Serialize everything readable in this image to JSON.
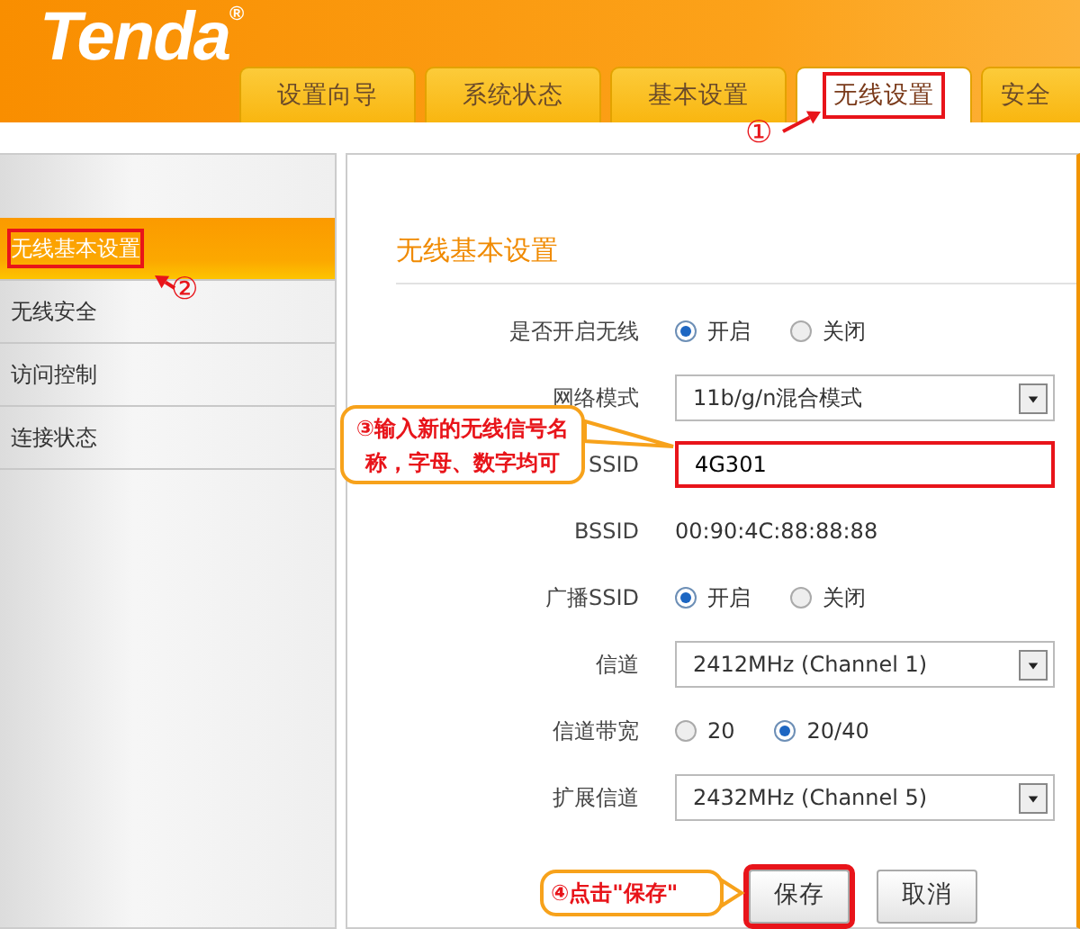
{
  "logo": {
    "text": "Tenda",
    "mark": "®"
  },
  "tabs": [
    {
      "label": "设置向导",
      "selected": false,
      "highlighted": false
    },
    {
      "label": "系统状态",
      "selected": false,
      "highlighted": false
    },
    {
      "label": "基本设置",
      "selected": false,
      "highlighted": false
    },
    {
      "label": "无线设置",
      "selected": true,
      "highlighted": true
    },
    {
      "label": "安全",
      "selected": false,
      "highlighted": false
    }
  ],
  "sidebar": {
    "items": [
      {
        "label": "无线基本设置",
        "selected": true,
        "highlighted": true
      },
      {
        "label": "无线安全",
        "selected": false,
        "highlighted": false
      },
      {
        "label": "访问控制",
        "selected": false,
        "highlighted": false
      },
      {
        "label": "连接状态",
        "selected": false,
        "highlighted": false
      }
    ]
  },
  "section_title": "无线基本设置",
  "fields": [
    {
      "kind": "radio",
      "label": "是否开启无线",
      "options": [
        {
          "label": "开启",
          "selected": true
        },
        {
          "label": "关闭",
          "selected": false
        }
      ]
    },
    {
      "kind": "select",
      "label": "网络模式",
      "value": "11b/g/n混合模式"
    },
    {
      "kind": "text",
      "label": "SSID",
      "value": "4G301",
      "highlighted": true
    },
    {
      "kind": "static",
      "label": "BSSID",
      "value": "00:90:4C:88:88:88"
    },
    {
      "kind": "radio",
      "label": "广播SSID",
      "options": [
        {
          "label": "开启",
          "selected": true
        },
        {
          "label": "关闭",
          "selected": false
        }
      ]
    },
    {
      "kind": "select",
      "label": "信道",
      "value": "2412MHz (Channel 1)"
    },
    {
      "kind": "radio",
      "label": "信道带宽",
      "options": [
        {
          "label": "20",
          "selected": false
        },
        {
          "label": "20/40",
          "selected": true
        }
      ]
    },
    {
      "kind": "select",
      "label": "扩展信道",
      "value": "2432MHz (Channel 5)"
    }
  ],
  "buttons": [
    {
      "label": "保存",
      "highlighted": true
    },
    {
      "label": "取消",
      "highlighted": false
    }
  ],
  "annotations": [
    {
      "kind": "marker",
      "text": "①"
    },
    {
      "kind": "marker",
      "text": "②"
    },
    {
      "kind": "callout",
      "lines": [
        "③输入新的无线信号名",
        "称，字母、数字均可"
      ]
    },
    {
      "kind": "callout",
      "lines": [
        "④点击\"保存\""
      ]
    }
  ]
}
